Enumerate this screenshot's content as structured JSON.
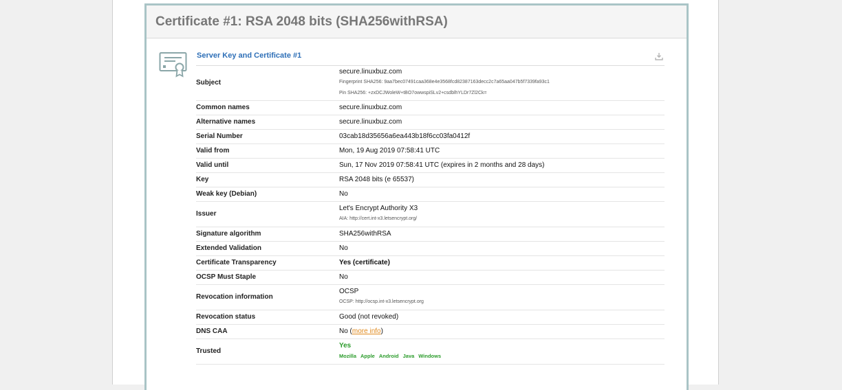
{
  "report": {
    "title": "Certificate #1: RSA 2048 bits (SHA256withRSA)",
    "section_title": "Server Key and Certificate #1",
    "icons": {
      "certificate": "certificate-icon",
      "download": "download-icon"
    }
  },
  "rows": {
    "subject": {
      "label": "Subject",
      "value": "secure.linuxbuz.com",
      "fingerprint": "Fingerprint SHA256: 9aa7bec07491caa368e4e3568fcd82387163decc2c7a65aa047b5f7339fa93c1",
      "pin": "Pin SHA256: +zxDCJWoleW+tBO7owwspiSLv2+csdblhYLDr7Zl2Ck="
    },
    "common_names": {
      "label": "Common names",
      "value": "secure.linuxbuz.com"
    },
    "alternative_names": {
      "label": "Alternative names",
      "value": "secure.linuxbuz.com"
    },
    "serial": {
      "label": "Serial Number",
      "value": "03cab18d35656a6ea443b18f6cc03fa0412f"
    },
    "valid_from": {
      "label": "Valid from",
      "value": "Mon, 19 Aug 2019 07:58:41 UTC"
    },
    "valid_until": {
      "label": "Valid until",
      "value": "Sun, 17 Nov 2019 07:58:41 UTC (expires in 2 months and 28 days)"
    },
    "key": {
      "label": "Key",
      "value": "RSA 2048 bits (e 65537)"
    },
    "weak_key": {
      "label": "Weak key (Debian)",
      "value": "No"
    },
    "issuer": {
      "label": "Issuer",
      "value": "Let's Encrypt Authority X3",
      "aia": "AIA: http://cert.int-x3.letsencrypt.org/"
    },
    "signature": {
      "label": "Signature algorithm",
      "value": "SHA256withRSA"
    },
    "ev": {
      "label": "Extended Validation",
      "value": "No"
    },
    "ct": {
      "label": "Certificate Transparency",
      "value": "Yes (certificate)"
    },
    "ocsp_staple": {
      "label": "OCSP Must Staple",
      "value": "No"
    },
    "revocation_info": {
      "label": "Revocation information",
      "value": "OCSP",
      "ocsp": "OCSP: http://ocsp.int-x3.letsencrypt.org"
    },
    "revocation_status": {
      "label": "Revocation status",
      "value": "Good (not revoked)"
    },
    "dns_caa": {
      "label": "DNS CAA",
      "value_prefix": "No (",
      "link": "more info",
      "value_suffix": ")"
    },
    "trusted": {
      "label": "Trusted",
      "value": "Yes",
      "clients": [
        "Mozilla",
        "Apple",
        "Android",
        "Java",
        "Windows"
      ]
    }
  },
  "colors": {
    "accent_blue": "#2e6fb7",
    "ok_green": "#2a9b2a",
    "warn_orange": "#e08a1e",
    "frame": "#a9c4c6"
  }
}
